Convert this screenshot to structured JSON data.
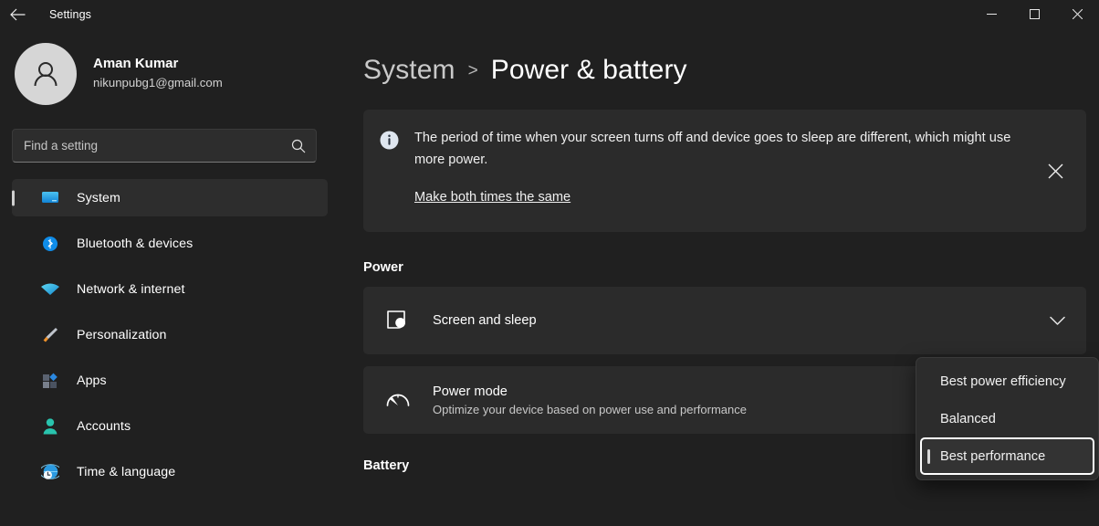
{
  "titlebar": {
    "back_label": "back-arrow",
    "title": "Settings",
    "minimize": "minimize",
    "maximize": "maximize",
    "close": "close"
  },
  "sidebar": {
    "profile": {
      "name": "Aman Kumar",
      "email": "nikunpubg1@gmail.com"
    },
    "search": {
      "placeholder": "Find a setting",
      "value": ""
    },
    "items": [
      {
        "label": "System",
        "icon": "monitor-icon",
        "active": true
      },
      {
        "label": "Bluetooth & devices",
        "icon": "bluetooth-icon",
        "active": false
      },
      {
        "label": "Network & internet",
        "icon": "wifi-icon",
        "active": false
      },
      {
        "label": "Personalization",
        "icon": "paintbrush-icon",
        "active": false
      },
      {
        "label": "Apps",
        "icon": "apps-icon",
        "active": false
      },
      {
        "label": "Accounts",
        "icon": "account-icon",
        "active": false
      },
      {
        "label": "Time & language",
        "icon": "clock-globe-icon",
        "active": false
      }
    ]
  },
  "main": {
    "breadcrumb": {
      "parent": "System",
      "separator": ">",
      "current": "Power & battery"
    },
    "banner": {
      "icon": "info-icon",
      "text": "The period of time when your screen turns off and device goes to sleep are different, which might use more power.",
      "link": "Make both times the same",
      "close_icon": "close-icon"
    },
    "power_section": {
      "title": "Power",
      "cards": [
        {
          "icon": "screen-sleep-icon",
          "title": "Screen and sleep",
          "subtitle": "",
          "chevron": "chevron-down-icon"
        },
        {
          "icon": "speedometer-icon",
          "title": "Power mode",
          "subtitle": "Optimize your device based on power use and performance",
          "chevron": ""
        }
      ]
    },
    "battery_section": {
      "title": "Battery"
    }
  },
  "dropdown": {
    "options": [
      {
        "label": "Best power efficiency",
        "selected": false
      },
      {
        "label": "Balanced",
        "selected": false
      },
      {
        "label": "Best performance",
        "selected": true
      }
    ]
  },
  "colors": {
    "page_background": "#202020",
    "card_background": "#2b2b2b",
    "accent_blue": "#0f8ce8",
    "focus_border": "#ffffff"
  }
}
